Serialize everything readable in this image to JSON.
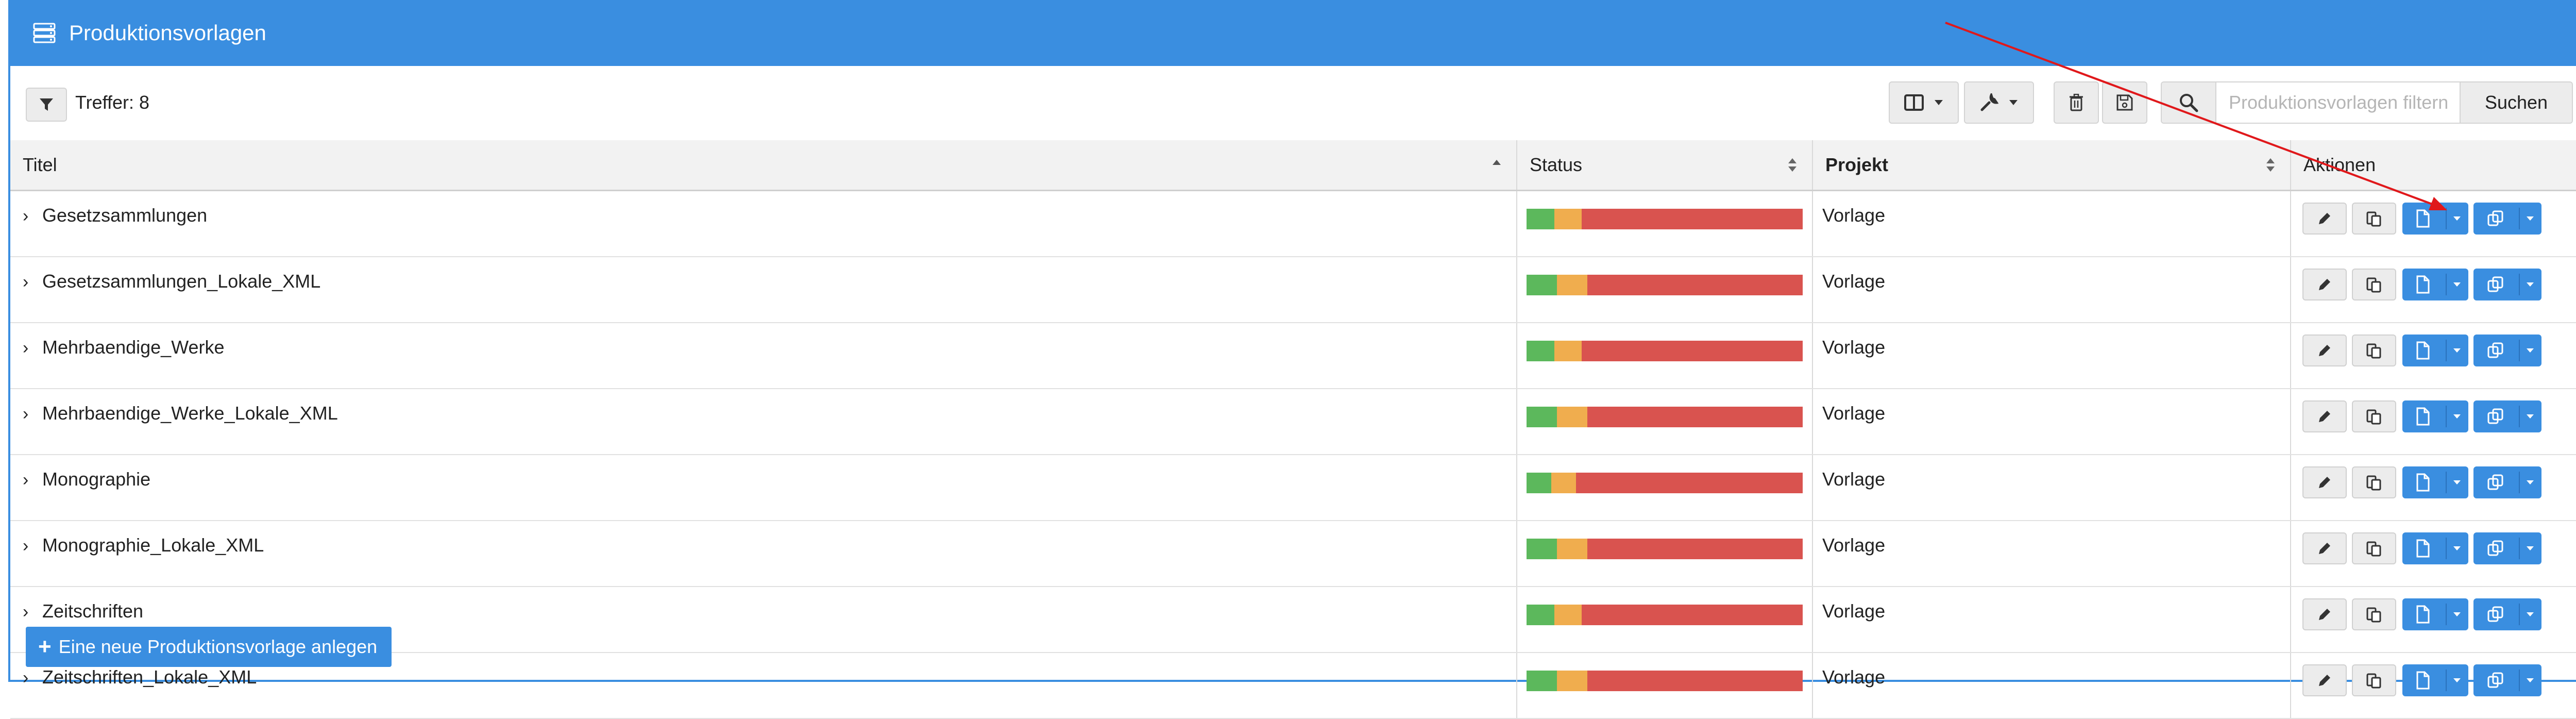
{
  "header": {
    "title": "Produktionsvorlagen",
    "icon": "server-icon"
  },
  "toolbar": {
    "hits_label": "Treffer: 8",
    "search": {
      "placeholder": "Produktionsvorlagen filtern",
      "value": "",
      "button_label": "Suchen"
    }
  },
  "table": {
    "columns": [
      "Titel",
      "Status",
      "Projekt",
      "Aktionen"
    ],
    "rows": [
      {
        "title": "Gesetzsammlungen",
        "project": "Vorlage",
        "status": {
          "green": 0.1,
          "yellow": 0.1,
          "red": 0.8
        }
      },
      {
        "title": "Gesetzsammlungen_Lokale_XML",
        "project": "Vorlage",
        "status": {
          "green": 0.11,
          "yellow": 0.11,
          "red": 0.78
        }
      },
      {
        "title": "Mehrbaendige_Werke",
        "project": "Vorlage",
        "status": {
          "green": 0.1,
          "yellow": 0.1,
          "red": 0.8
        }
      },
      {
        "title": "Mehrbaendige_Werke_Lokale_XML",
        "project": "Vorlage",
        "status": {
          "green": 0.11,
          "yellow": 0.11,
          "red": 0.78
        }
      },
      {
        "title": "Monographie",
        "project": "Vorlage",
        "status": {
          "green": 0.09,
          "yellow": 0.09,
          "red": 0.82
        }
      },
      {
        "title": "Monographie_Lokale_XML",
        "project": "Vorlage",
        "status": {
          "green": 0.11,
          "yellow": 0.11,
          "red": 0.78
        }
      },
      {
        "title": "Zeitschriften",
        "project": "Vorlage",
        "status": {
          "green": 0.1,
          "yellow": 0.1,
          "red": 0.8
        }
      },
      {
        "title": "Zeitschriften_Lokale_XML",
        "project": "Vorlage",
        "status": {
          "green": 0.11,
          "yellow": 0.11,
          "red": 0.78
        }
      }
    ]
  },
  "footer": {
    "add_button_label": "Eine neue Produktionsvorlage anlegen"
  },
  "colors": {
    "primary": "#3a8ee0",
    "status_green": "#5cb85c",
    "status_yellow": "#f0ad4e",
    "status_red": "#d9534f",
    "annotation": "#e0181b"
  }
}
